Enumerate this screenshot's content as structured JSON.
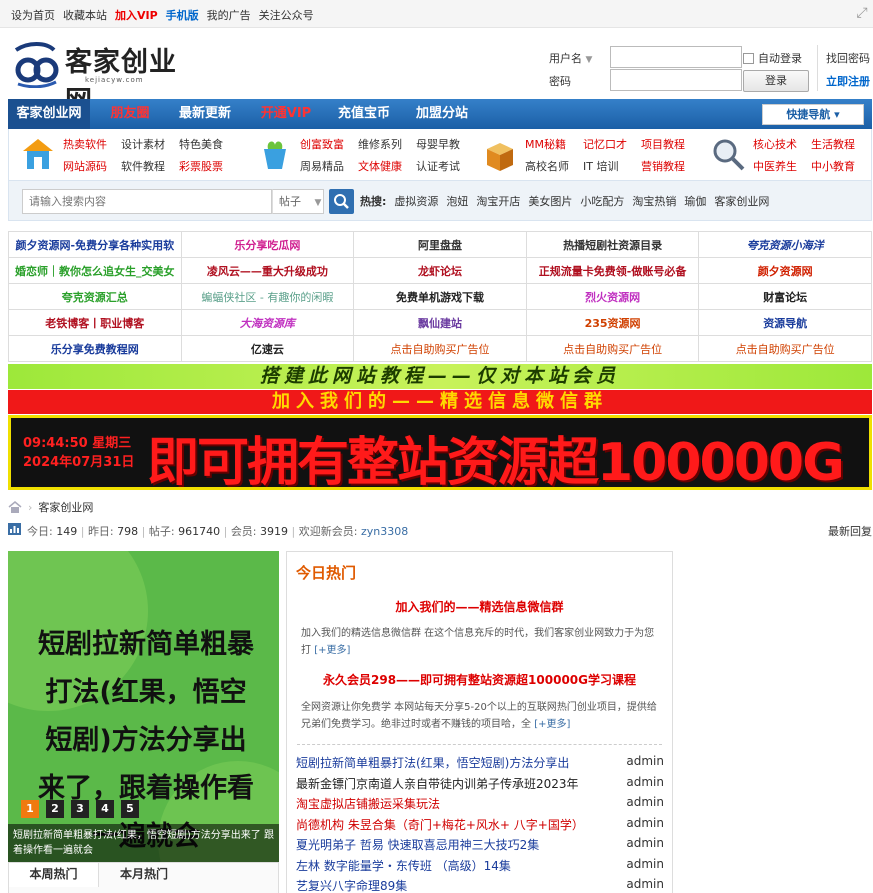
{
  "topbar": {
    "links": [
      {
        "label": "设为首页",
        "style": "normal"
      },
      {
        "label": "收藏本站",
        "style": "normal"
      },
      {
        "label": "加入VIP",
        "style": "red"
      },
      {
        "label": "手机版",
        "style": "blue"
      },
      {
        "label": "我的广告",
        "style": "normal"
      },
      {
        "label": "关注公众号",
        "style": "normal"
      }
    ],
    "expand_icon": "fullscreen-icon"
  },
  "logo": {
    "name": "客家创业网",
    "domain": "kejiacyw.com"
  },
  "login": {
    "username_label": "用户名",
    "password_label": "密码",
    "auto_login": "自动登录",
    "login_button": "登录",
    "find_password": "找回密码",
    "register": "立即注册"
  },
  "nav": {
    "items": [
      {
        "label": "客家创业网",
        "color": "#ffffff"
      },
      {
        "label": "朋友圈",
        "color": "#ff3333"
      },
      {
        "label": "最新更新",
        "color": "#ffffff"
      },
      {
        "label": "开通VIP",
        "color": "#ff3333"
      },
      {
        "label": "充值宝币",
        "color": "#ffffff"
      },
      {
        "label": "加盟分站",
        "color": "#ffffff"
      }
    ],
    "quick_nav": "快捷导航"
  },
  "categories": [
    {
      "icon": "house-icon",
      "items": [
        {
          "t": "热卖软件",
          "red": true
        },
        {
          "t": "设计素材",
          "red": false
        },
        {
          "t": "特色美食",
          "red": false
        },
        {
          "t": "网站源码",
          "red": true
        },
        {
          "t": "软件教程",
          "red": false
        },
        {
          "t": "彩票股票",
          "red": true
        }
      ]
    },
    {
      "icon": "cup-icon",
      "items": [
        {
          "t": "创富致富",
          "red": true
        },
        {
          "t": "维修系列",
          "red": false
        },
        {
          "t": "母婴早教",
          "red": false
        },
        {
          "t": "周易精品",
          "red": false
        },
        {
          "t": "文体健康",
          "red": true
        },
        {
          "t": "认证考试",
          "red": false
        }
      ]
    },
    {
      "icon": "box-icon",
      "items": [
        {
          "t": "MM秘籍",
          "red": true
        },
        {
          "t": "记忆口才",
          "red": true
        },
        {
          "t": "项目教程",
          "red": true
        },
        {
          "t": "高校名师",
          "red": false
        },
        {
          "t": "IT 培训",
          "red": false
        },
        {
          "t": "营销教程",
          "red": true
        }
      ]
    },
    {
      "icon": "magnifier-icon",
      "items": [
        {
          "t": "核心技术",
          "red": true
        },
        {
          "t": "生活教程",
          "red": true
        },
        {
          "t": "中医养生",
          "red": true
        },
        {
          "t": "中小教育",
          "red": true
        }
      ]
    }
  ],
  "search": {
    "placeholder": "请输入搜索内容",
    "scope": "帖子",
    "hot_label": "热搜:",
    "hot": [
      "虚拟资源",
      "泡妞",
      "淘宝开店",
      "美女图片",
      "小吃配方",
      "淘宝热销",
      "瑜伽",
      "客家创业网"
    ]
  },
  "friend_links": [
    [
      {
        "t": "颜夕资源网-免费分享各种实用软",
        "c": "#1a3c9c"
      },
      {
        "t": "乐分享吃瓜网",
        "c": "#d02090"
      },
      {
        "t": "阿里盘盘",
        "c": "#333333"
      },
      {
        "t": "热播短剧社资源目录",
        "c": "#333333"
      },
      {
        "t": "夸克资源小海洋",
        "c": "#1a3c9c",
        "italic": true
      }
    ],
    [
      {
        "t": "婚恋师｜教你怎么追女生_交美女",
        "c": "#2aa02a"
      },
      {
        "t": "凌风云——重大升级成功",
        "c": "#b01020"
      },
      {
        "t": "龙虾论坛",
        "c": "#b01020"
      },
      {
        "t": "正规流量卡免费领-做账号必备",
        "c": "#b01020"
      },
      {
        "t": "颜夕资源网",
        "c": "#d02000"
      }
    ],
    [
      {
        "t": "夸克资源汇总",
        "c": "#2aa02a"
      },
      {
        "t": "蝙蝠侠社区 - 有趣你的闲暇",
        "c": "#5aa08a"
      },
      {
        "t": "免费单机游戏下载",
        "c": "#222222"
      },
      {
        "t": "烈火资源网",
        "c": "#c030c0"
      },
      {
        "t": "财富论坛",
        "c": "#222222"
      }
    ],
    [
      {
        "t": "老铁博客丨职业博客",
        "c": "#b01020"
      },
      {
        "t": "大海资源库",
        "c": "#c030c0",
        "italic": true
      },
      {
        "t": "飘仙建站",
        "c": "#6a3aa0"
      },
      {
        "t": "235资源网",
        "c": "#d04000"
      },
      {
        "t": "资源导航",
        "c": "#1a3c9c"
      }
    ],
    [
      {
        "t": "乐分享免费教程网",
        "c": "#1a3c9c"
      },
      {
        "t": "亿速云",
        "c": "#222222"
      },
      {
        "t": "点击自助购买广告位",
        "c": "#d04000"
      },
      {
        "t": "点击自助购买广告位",
        "c": "#d04000"
      },
      {
        "t": "点击自助购买广告位",
        "c": "#d04000"
      }
    ]
  ],
  "banners": {
    "tutorial": "搭建此网站教程——仅对本站会员",
    "wechat": "加入我们的——精选信息微信群",
    "time": "09:44:50 星期三",
    "date": "2024年07月31日",
    "big": "即可拥有整站资源超100000G"
  },
  "breadcrumb": {
    "current": "客家创业网"
  },
  "stats": {
    "today_label": "今日:",
    "today": "149",
    "yesterday_label": "昨日:",
    "yesterday": "798",
    "posts_label": "帖子:",
    "posts": "961740",
    "members_label": "会员:",
    "members": "3919",
    "welcome": "欢迎新会员:",
    "new_user": "zyn3308",
    "latest_reply": "最新回复"
  },
  "slideshow": {
    "text": "短剧拉新简单粗暴打法(红果，悟空短剧)方法分享出来了，跟着操作看一遍就会",
    "pages": [
      "1",
      "2",
      "3",
      "4",
      "5"
    ],
    "active_page": 1,
    "caption": "短剧拉新简单粗暴打法(红果，悟空短剧)方法分享出来了 跟着操作看一遍就会"
  },
  "bottom_tabs": [
    "本周热门",
    "本月热门"
  ],
  "hot_today": {
    "heading": "今日热门",
    "headline1": "加入我们的——精选信息微信群",
    "desc1": "加入我们的精选信息微信群 在这个信息充斥的时代，我们客家创业网致力于为您打",
    "more1": "[+更多]",
    "headline2": "永久会员298——即可拥有整站资源超100000G学习课程",
    "desc2": "全网资源让你免费学 本网站每天分享5-20个以上的互联网热门创业项目，提供给兄弟们免费学习。绝非过时或者不赚钱的项目哈，全",
    "more2": "[+更多]",
    "list": [
      {
        "title": "短剧拉新简单粗暴打法(红果，悟空短剧)方法分享出",
        "author": "admin",
        "color": "#1a3c9c"
      },
      {
        "title": "最新金镖门京南道人亲自带徒内训弟子传承班2023年",
        "author": "admin",
        "color": "#222222"
      },
      {
        "title": "淘宝虚拟店铺搬运采集玩法",
        "author": "admin",
        "color": "#d00000"
      },
      {
        "title": "尚德机构 朱昱合集（奇门+梅花+风水+ 八字+国学）",
        "author": "admin",
        "color": "#d00000"
      },
      {
        "title": "夏光明弟子 哲易 快速取喜忌用神三大技巧2集",
        "author": "admin",
        "color": "#1a3c9c"
      },
      {
        "title": "左林 数字能量学・东传班 （高级）14集",
        "author": "admin",
        "color": "#1a3c9c"
      },
      {
        "title": "艺复兴八字命理89集",
        "author": "admin",
        "color": "#1a3c9c"
      }
    ]
  }
}
